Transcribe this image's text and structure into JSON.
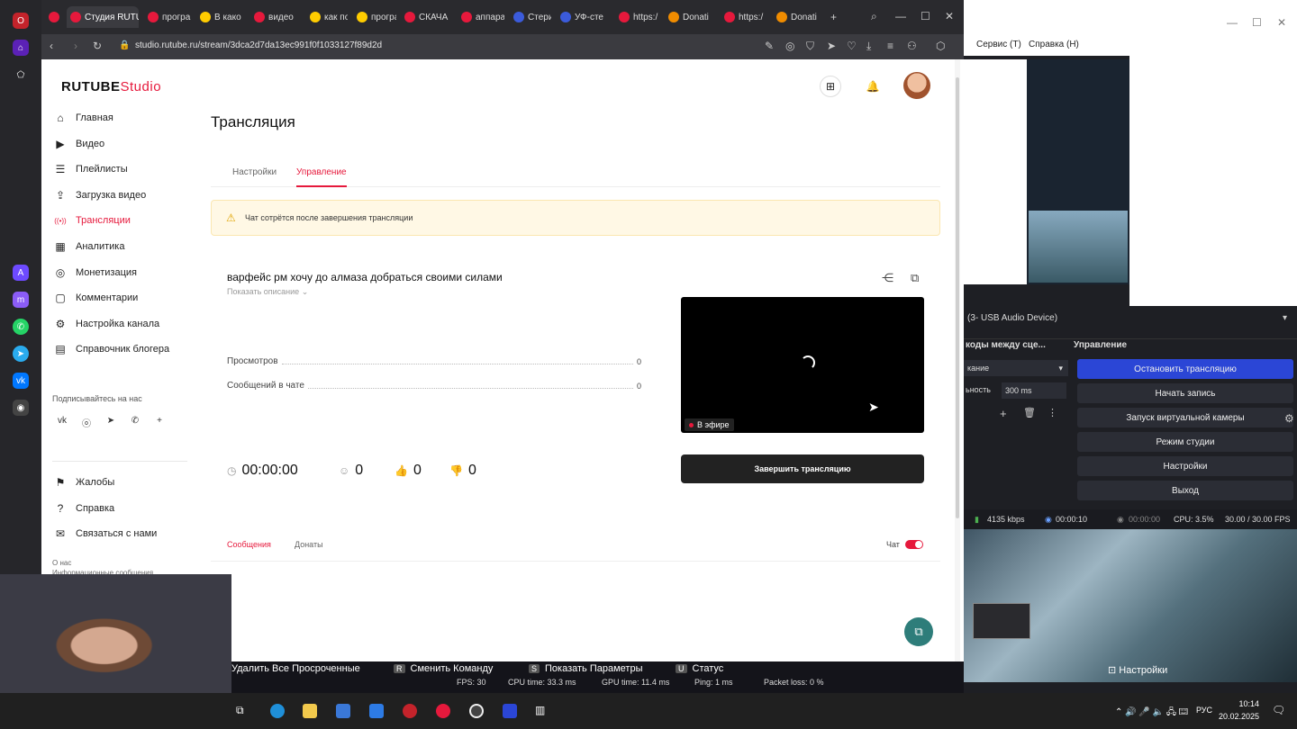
{
  "browser": {
    "tabs": [
      {
        "label": "",
        "color": "#c4232b"
      },
      {
        "label": "R",
        "color": "#e6193c"
      },
      {
        "label": "Студия RUTU",
        "color": "#e6193c",
        "active": true
      },
      {
        "label": "програ",
        "color": "#e6193c"
      },
      {
        "label": "В како",
        "color": "#ffcc00"
      },
      {
        "label": "видео",
        "color": "#e6193c"
      },
      {
        "label": "как по",
        "color": "#ffcc00"
      },
      {
        "label": "програ",
        "color": "#ffcc00"
      },
      {
        "label": "СКАЧА",
        "color": "#e6193c"
      },
      {
        "label": "аппара",
        "color": "#e6193c"
      },
      {
        "label": "Стери",
        "color": "#3b5bdb"
      },
      {
        "label": "УФ-сте",
        "color": "#3b5bdb"
      },
      {
        "label": "https:/",
        "color": "#e6193c"
      },
      {
        "label": "Donati",
        "color": "#f08c00"
      },
      {
        "label": "https:/",
        "color": "#e6193c"
      },
      {
        "label": "Donati",
        "color": "#f08c00"
      }
    ],
    "url": "studio.rutube.ru/stream/3dca2d7da13ec991f0f1033127f89d2d"
  },
  "sidebar": {
    "logo_main": "RUTUBE",
    "logo_sub": "Studio",
    "items": [
      {
        "label": "Главная",
        "icon": "home-icon"
      },
      {
        "label": "Видео",
        "icon": "video-icon"
      },
      {
        "label": "Плейлисты",
        "icon": "playlist-icon"
      },
      {
        "label": "Загрузка видео",
        "icon": "upload-icon"
      },
      {
        "label": "Трансляции",
        "icon": "broadcast-icon",
        "active": true
      },
      {
        "label": "Аналитика",
        "icon": "analytics-icon"
      },
      {
        "label": "Монетизация",
        "icon": "coin-icon"
      },
      {
        "label": "Комментарии",
        "icon": "comment-icon"
      },
      {
        "label": "Настройка канала",
        "icon": "gear-icon"
      },
      {
        "label": "Справочник блогера",
        "icon": "book-icon"
      }
    ],
    "follow_label": "Подписывайтесь на нас",
    "bottom_items": [
      {
        "label": "Жалобы",
        "icon": "flag-icon"
      },
      {
        "label": "Справка",
        "icon": "help-icon"
      },
      {
        "label": "Связаться с нами",
        "icon": "mail-icon"
      }
    ],
    "footer_links": [
      "О нас",
      "Информационные сообщения"
    ]
  },
  "header": {
    "page_title": "Трансляция",
    "tabs": [
      "Настройки",
      "Управление"
    ],
    "active_tab": "Управление"
  },
  "notice": {
    "text": "Чат сотрётся после завершения трансляции"
  },
  "stream": {
    "title": "варфейс рм хочу до алмаза добраться своими силами",
    "show_description": "Показать описание",
    "stats": [
      {
        "label": "Просмотров",
        "value": "0"
      },
      {
        "label": "Сообщений в чате",
        "value": "0"
      }
    ],
    "live_badge": "В эфире",
    "duration": "00:00:00",
    "viewers": "0",
    "likes": "0",
    "dislikes": "0",
    "end_button": "Завершить трансляцию"
  },
  "chat": {
    "tabs": [
      "Сообщения",
      "Донаты"
    ],
    "active_tab": "Сообщения",
    "toggle_label": "Чат",
    "toggle_on": true
  },
  "obs": {
    "menu": [
      "Сервис (T)",
      "Справка (H)"
    ],
    "audio_device": "(3- USB Audio Device)",
    "transitions_header": "коды между сце...",
    "transition_value": "кание",
    "duration_label": "ьность",
    "duration_value": "300 ms",
    "controls_header": "Управление",
    "controls": [
      {
        "label": "Остановить трансляцию",
        "primary": true
      },
      {
        "label": "Начать запись"
      },
      {
        "label": "Запуск виртуальной камеры"
      },
      {
        "label": "Режим студии"
      },
      {
        "label": "Настройки"
      },
      {
        "label": "Выход"
      }
    ],
    "status": {
      "bitrate": "4135 kbps",
      "live_time": "00:00:10",
      "rec_time": "00:00:00",
      "cpu": "CPU: 3.5%",
      "fps": "30.00 / 30.00 FPS"
    },
    "overlay_settings": "Настройки"
  },
  "game_hud": {
    "commands": [
      {
        "key": "",
        "label": "Удалить Все Просроченные"
      },
      {
        "key": "R",
        "label": "Сменить Команду"
      },
      {
        "key": "S",
        "label": "Показать Параметры"
      },
      {
        "key": "U",
        "label": "Статус"
      }
    ],
    "perf": {
      "fps": "FPS: 30",
      "cpu": "CPU time: 33.3 ms",
      "gpu": "GPU time: 11.4 ms",
      "ping": "Ping: 1 ms",
      "loss": "Packet loss: 0 %"
    }
  },
  "taskbar": {
    "lang": "РУС",
    "time": "10:14",
    "date": "20.02.2025"
  }
}
